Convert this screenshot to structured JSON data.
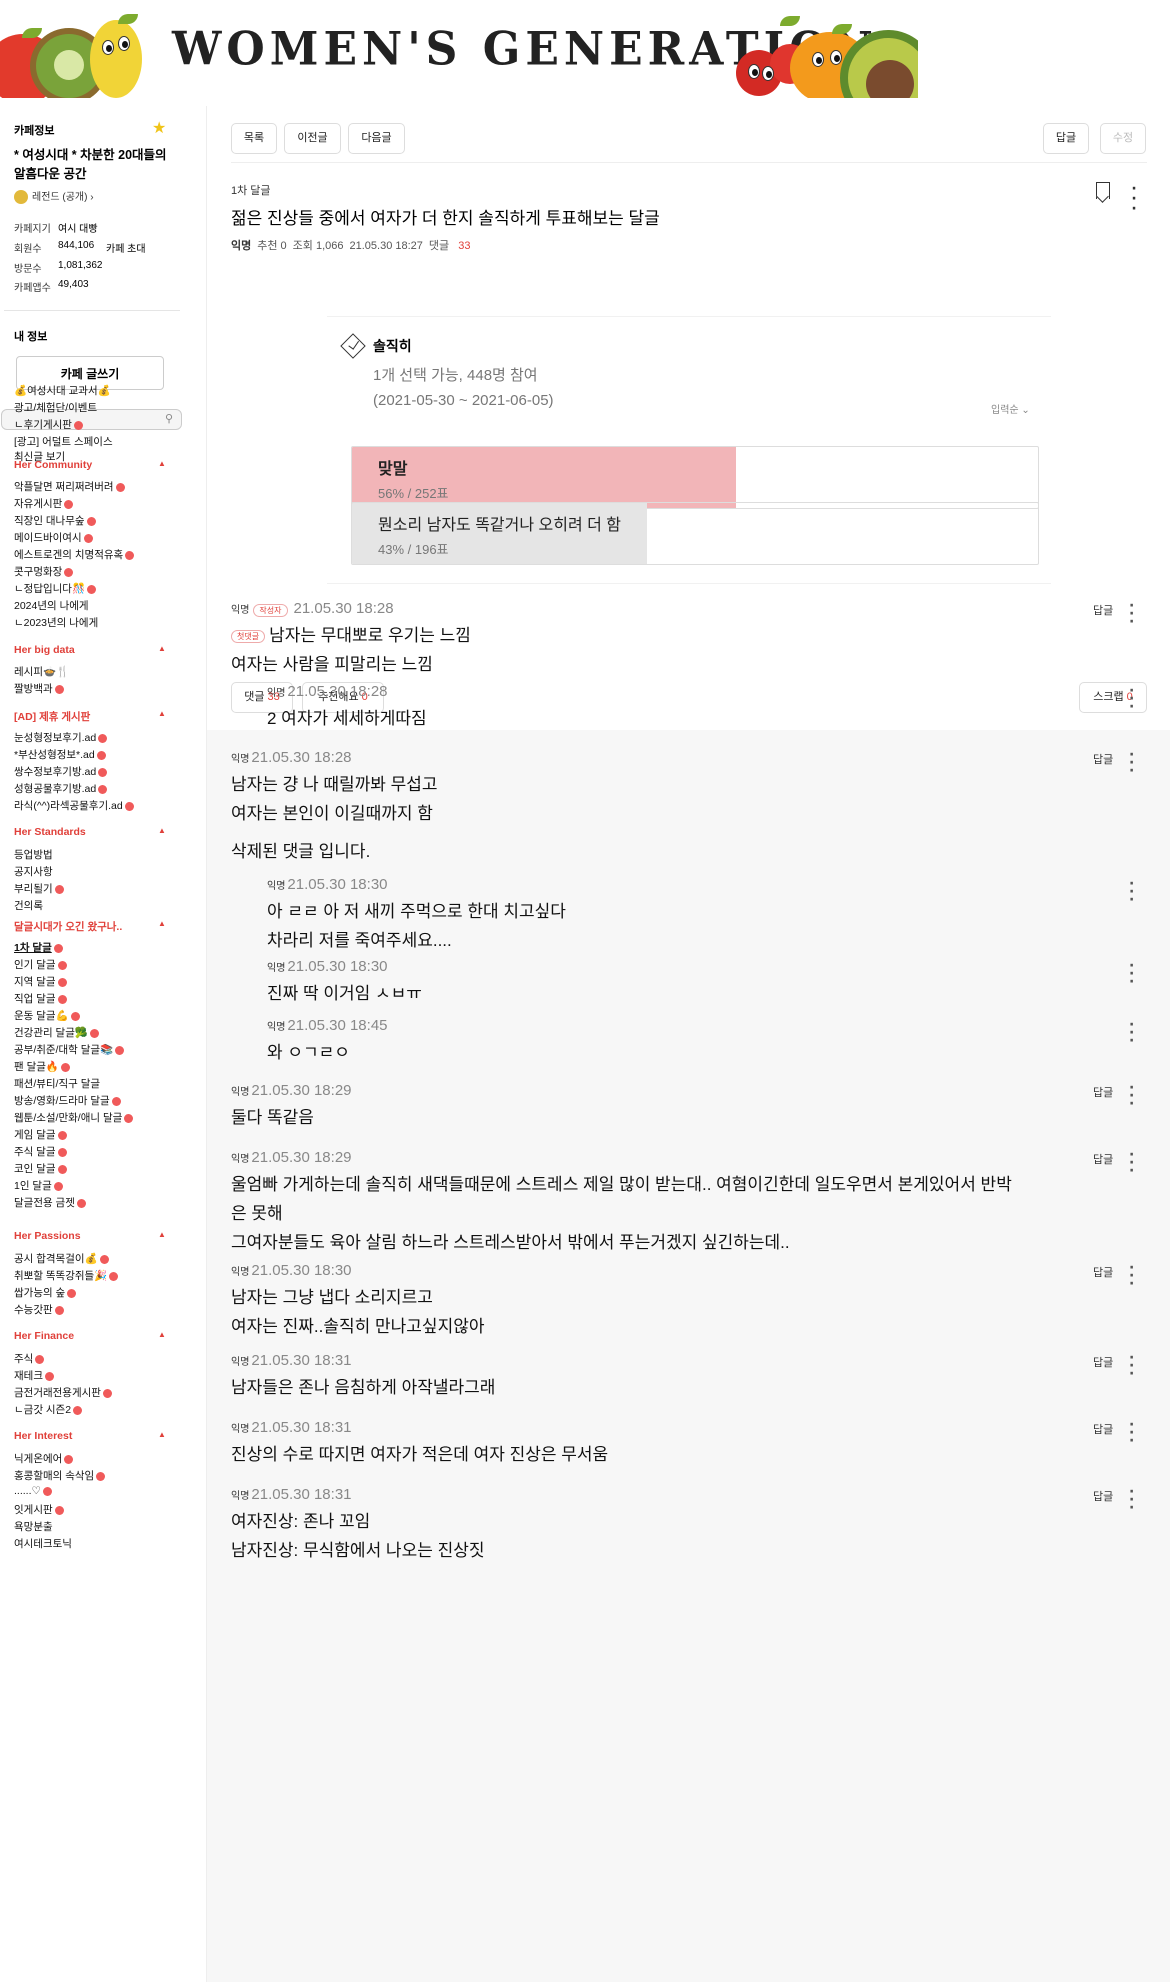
{
  "banner": {
    "title": "WOMEN'S GENERATION"
  },
  "sidebar": {
    "cafe_info_label": "카페정보",
    "cafe_title": "* 여성시대 * 차분한 20대들의 알흠다운 공간",
    "rank": "레전드 (공개)",
    "manager_label": "카페지기",
    "manager": "여시 대빵",
    "members_label": "회원수",
    "members": "844,106",
    "invite": "카페 초대",
    "visitors_label": "방문수",
    "visitors": "1,081,362",
    "likes_label": "카페앱수",
    "likes": "49,403",
    "my_info": "내 정보",
    "write_button": "카페 글쓰기",
    "recent_posts": "최신글 보기",
    "items_top": [
      "💰여성시대 교과서💰",
      "광고/체험단/이벤트",
      "ㄴ후기게시판",
      "[광고] 어덜트 스페이스"
    ],
    "groups": [
      {
        "title": "Her Community",
        "items": [
          "악플달면 쩌리쩌려버려",
          "자유게시판",
          "직장인 대나무숲",
          "메이드바이여시",
          "에스트로겐의 치명적유혹",
          "콧구멍화장",
          "ㄴ정답입니다🎊",
          "2024년의 나에게",
          "ㄴ2023년의 나에게"
        ]
      },
      {
        "title": "Her big data",
        "items": [
          "레시피🍲🍴",
          "짤방백과"
        ]
      },
      {
        "title": "[AD] 제휴 게시판",
        "items": [
          "눈성형정보후기.ad",
          "*부산성형정보*.ad",
          "쌍수정보후기방.ad",
          "성형공물후기방.ad",
          "라식(^^)라섹공물후기.ad"
        ]
      },
      {
        "title": "Her Standards",
        "items": [
          "등업방법",
          "공지사항",
          "부리될기",
          "건의록"
        ]
      },
      {
        "title": "달글시대가 오긴 왔구나..",
        "items": [
          "1차 달글",
          "인기 달글",
          "지역 달글",
          "직업 달글",
          "운동 달글💪",
          "건강관리 달글🥦",
          "공부/취준/대학 달글📚",
          "팬 달글🔥",
          "패션/뷰티/직구 달글",
          "방송/영화/드라마 달글",
          "웹툰/소설/만화/애니 달글",
          "게임 달글",
          "주식 달글",
          "코인 달글",
          "1인 달글",
          "달글전용 금젯"
        ]
      },
      {
        "title": "Her Passions",
        "items": [
          "공시 합격목걸이💰",
          "취뽀할 똑똑강쥐들🎉",
          "쌉가능의 숲",
          "수능갓판"
        ]
      },
      {
        "title": "Her Finance",
        "items": [
          "주식",
          "재테크",
          "금전거래전용게시판",
          "ㄴ금갓 시즌2"
        ]
      },
      {
        "title": "Her Interest",
        "items": [
          "닉게온에어",
          "홍콩할매의 속삭임",
          "......♡",
          "잇게시판",
          "욕망분출",
          "여시테크토닉"
        ]
      }
    ]
  },
  "toolbar": {
    "list": "목록",
    "prev": "이전글",
    "next": "다음글",
    "reply": "답글",
    "edit": "수정"
  },
  "post": {
    "board": "1차 달글",
    "title": "젊은 진상들 중에서 여자가 더 한지 솔직하게 투표해보는 달글",
    "author": "익명",
    "recommend": "추천 0",
    "views": "조회 1,066",
    "date": "21.05.30 18:27",
    "comments_label": "댓글",
    "comments_count": "33"
  },
  "poll": {
    "title": "솔직히",
    "info1": "1개 선택 가능, 448명 참여",
    "info2": "(2021-05-30 ~ 2021-06-05)",
    "sort": "입력순 ⌄",
    "options": [
      {
        "label": "맞말",
        "stat": "56% / 252표",
        "pct": 56,
        "color": "#f2b5b8"
      },
      {
        "label": "뭔소리 남자도 똑같거나 오히려 더 함",
        "stat": "43% / 196표",
        "pct": 43,
        "color": "#e5e5e5"
      }
    ]
  },
  "actions": {
    "comment": "댓글",
    "comment_count": "33",
    "like": "추천해요",
    "like_count": "0",
    "scrap": "스크랩",
    "scrap_count": "0"
  },
  "comments": [
    {
      "author": "익명",
      "badge": "작성자",
      "date": "21.05.30 18:28",
      "first": "첫댓글",
      "lines": [
        "남자는 무대뽀로 우기는 느낌",
        "여자는 사람을 피말리는 느낌"
      ]
    },
    {
      "author": "익명",
      "date": "21.05.30 18:28",
      "lines": [
        "2 여자가 세세하게따짐"
      ]
    },
    {
      "author": "익명",
      "date": "21.05.30 18:28",
      "lines": [
        "남자는 걍 나 때릴까봐 무섭고",
        "여자는 본인이 이길때까지 함"
      ]
    },
    {
      "deleted": "삭제된 댓글 입니다."
    },
    {
      "author": "익명",
      "date": "21.05.30 18:30",
      "lines": [
        "아 ㄹㄹ 아 저 새끼 주먹으로 한대 치고싶다",
        "차라리 저를 죽여주세요...."
      ]
    },
    {
      "author": "익명",
      "date": "21.05.30 18:30",
      "lines": [
        "진짜 딱 이거임 ㅅㅂㅠ"
      ]
    },
    {
      "author": "익명",
      "date": "21.05.30 18:45",
      "lines": [
        "와 ㅇㄱㄹㅇ"
      ]
    },
    {
      "author": "익명",
      "date": "21.05.30 18:29",
      "lines": [
        "둘다 똑같음"
      ]
    },
    {
      "author": "익명",
      "date": "21.05.30 18:29",
      "lines": [
        "울엄빠 가게하는데 솔직히 새댁들때문에 스트레스 제일 많이 받는대.. 여혐이긴한데 일도우면서 본게있어서 반박",
        "은 못해",
        "그여자분들도 육아 살림 하느라 스트레스받아서 밖에서 푸는거겠지 싶긴하는데.."
      ]
    },
    {
      "author": "익명",
      "date": "21.05.30 18:30",
      "lines": [
        "남자는 그냥 냅다 소리지르고",
        "여자는 진짜..솔직히 만나고싶지않아"
      ]
    },
    {
      "author": "익명",
      "date": "21.05.30 18:31",
      "lines": [
        "남자들은 존나 음침하게 아작낼라그래"
      ]
    },
    {
      "author": "익명",
      "date": "21.05.30 18:31",
      "lines": [
        "진상의 수로 따지면 여자가 적은데 여자 진상은 무서움"
      ]
    },
    {
      "author": "익명",
      "date": "21.05.30 18:31",
      "lines": [
        "여자진상: 존나 꼬임",
        "남자진상: 무식함에서 나오는 진상짓"
      ]
    }
  ],
  "reply_label": "답글"
}
